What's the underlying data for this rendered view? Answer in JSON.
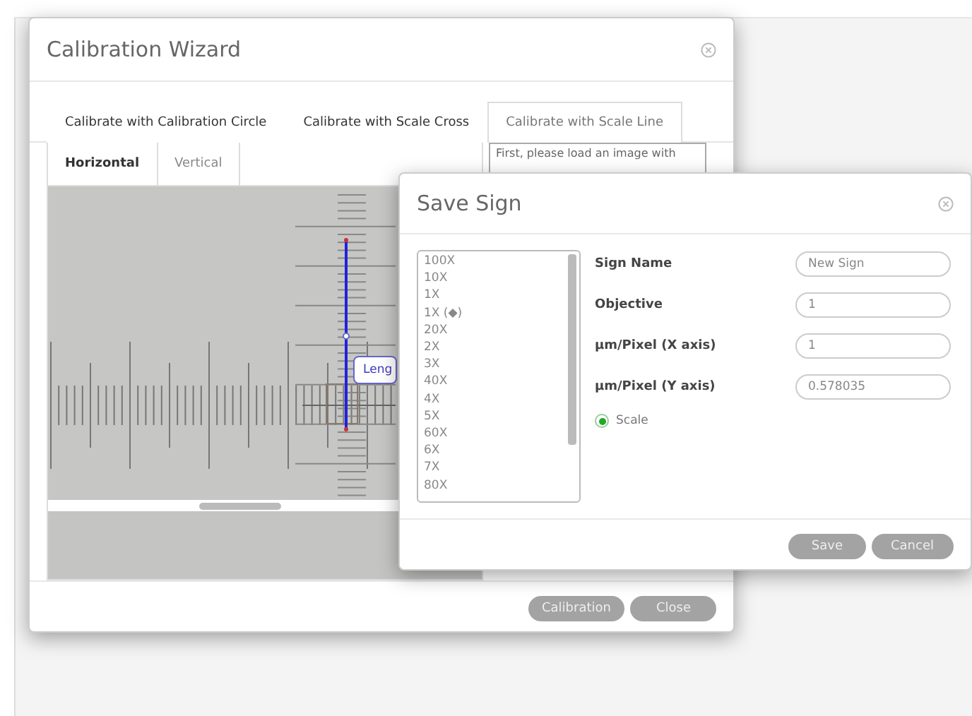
{
  "wizard": {
    "title": "Calibration Wizard",
    "tabs": [
      {
        "label": "Calibrate with Calibration Circle",
        "selected": false
      },
      {
        "label": "Calibrate with Scale Cross",
        "selected": false
      },
      {
        "label": "Calibrate with Scale Line",
        "selected": true
      }
    ],
    "subtabs": [
      {
        "label": "Horizontal",
        "selected": true
      },
      {
        "label": "Vertical",
        "selected": false
      }
    ],
    "measurement_label": "Leng",
    "instructions": "First, please load an image with",
    "buttons": [
      "Calibration",
      "Close"
    ]
  },
  "save_sign": {
    "title": "Save Sign",
    "signs": [
      {
        "label": "100X",
        "selected": false
      },
      {
        "label": "10X",
        "selected": false
      },
      {
        "label": "1X",
        "selected": false
      },
      {
        "label": "1X (◆)",
        "selected": false
      },
      {
        "label": "20X",
        "selected": false
      },
      {
        "label": "2X",
        "selected": false
      },
      {
        "label": "3X",
        "selected": false
      },
      {
        "label": "40X",
        "selected": false
      },
      {
        "label": "4X",
        "selected": false
      },
      {
        "label": "5X",
        "selected": false
      },
      {
        "label": "60X",
        "selected": false
      },
      {
        "label": "6X",
        "selected": false
      },
      {
        "label": "7X",
        "selected": false
      },
      {
        "label": "80X",
        "selected": false
      }
    ],
    "fields": [
      {
        "label": "Sign Name",
        "value": "New Sign"
      },
      {
        "label": "Objective",
        "value": "1"
      },
      {
        "label": "µm/Pixel (X axis)",
        "value": "1"
      },
      {
        "label": "µm/Pixel (Y axis)",
        "value": "0.578035"
      }
    ],
    "radio": {
      "label": "Scale",
      "checked": true
    },
    "buttons": [
      "Save",
      "Cancel"
    ]
  }
}
